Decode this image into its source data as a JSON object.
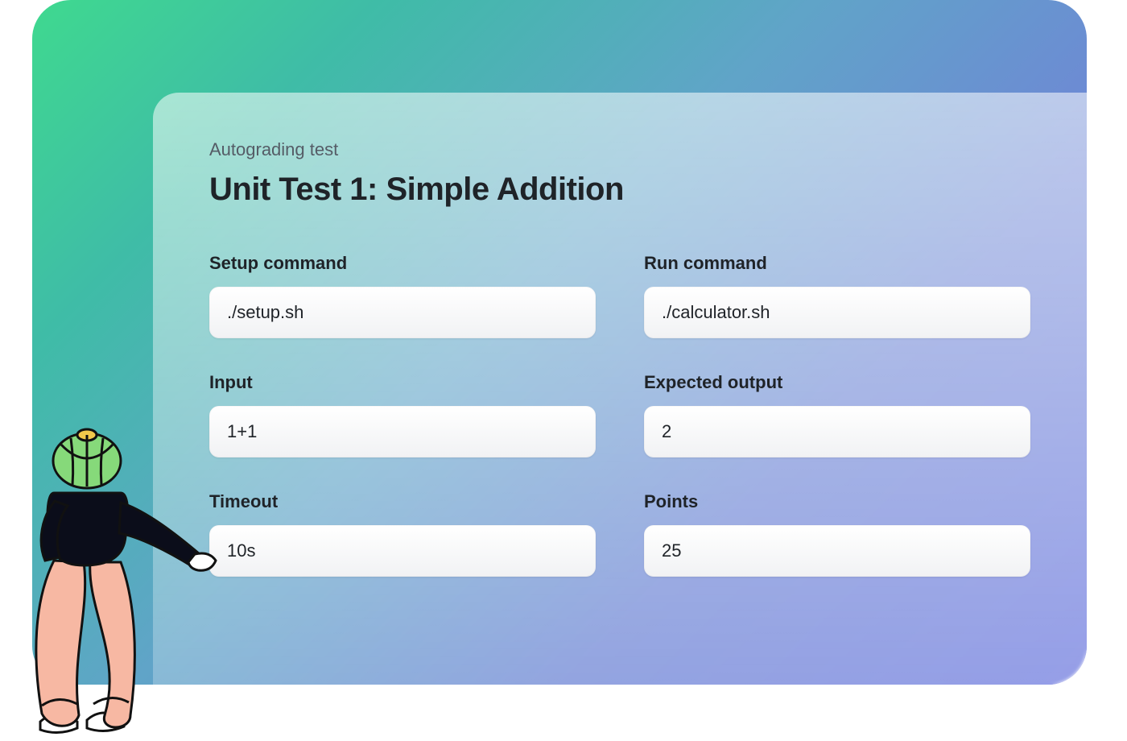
{
  "header": {
    "eyebrow": "Autograding test",
    "title": "Unit Test 1: Simple Addition"
  },
  "fields": {
    "setup_command": {
      "label": "Setup command",
      "value": "./setup.sh"
    },
    "run_command": {
      "label": "Run command",
      "value": "./calculator.sh"
    },
    "input": {
      "label": "Input",
      "value": "1+1"
    },
    "expected": {
      "label": "Expected output",
      "value": "2"
    },
    "timeout": {
      "label": "Timeout",
      "value": "10s"
    },
    "points": {
      "label": "Points",
      "value": "25"
    }
  }
}
